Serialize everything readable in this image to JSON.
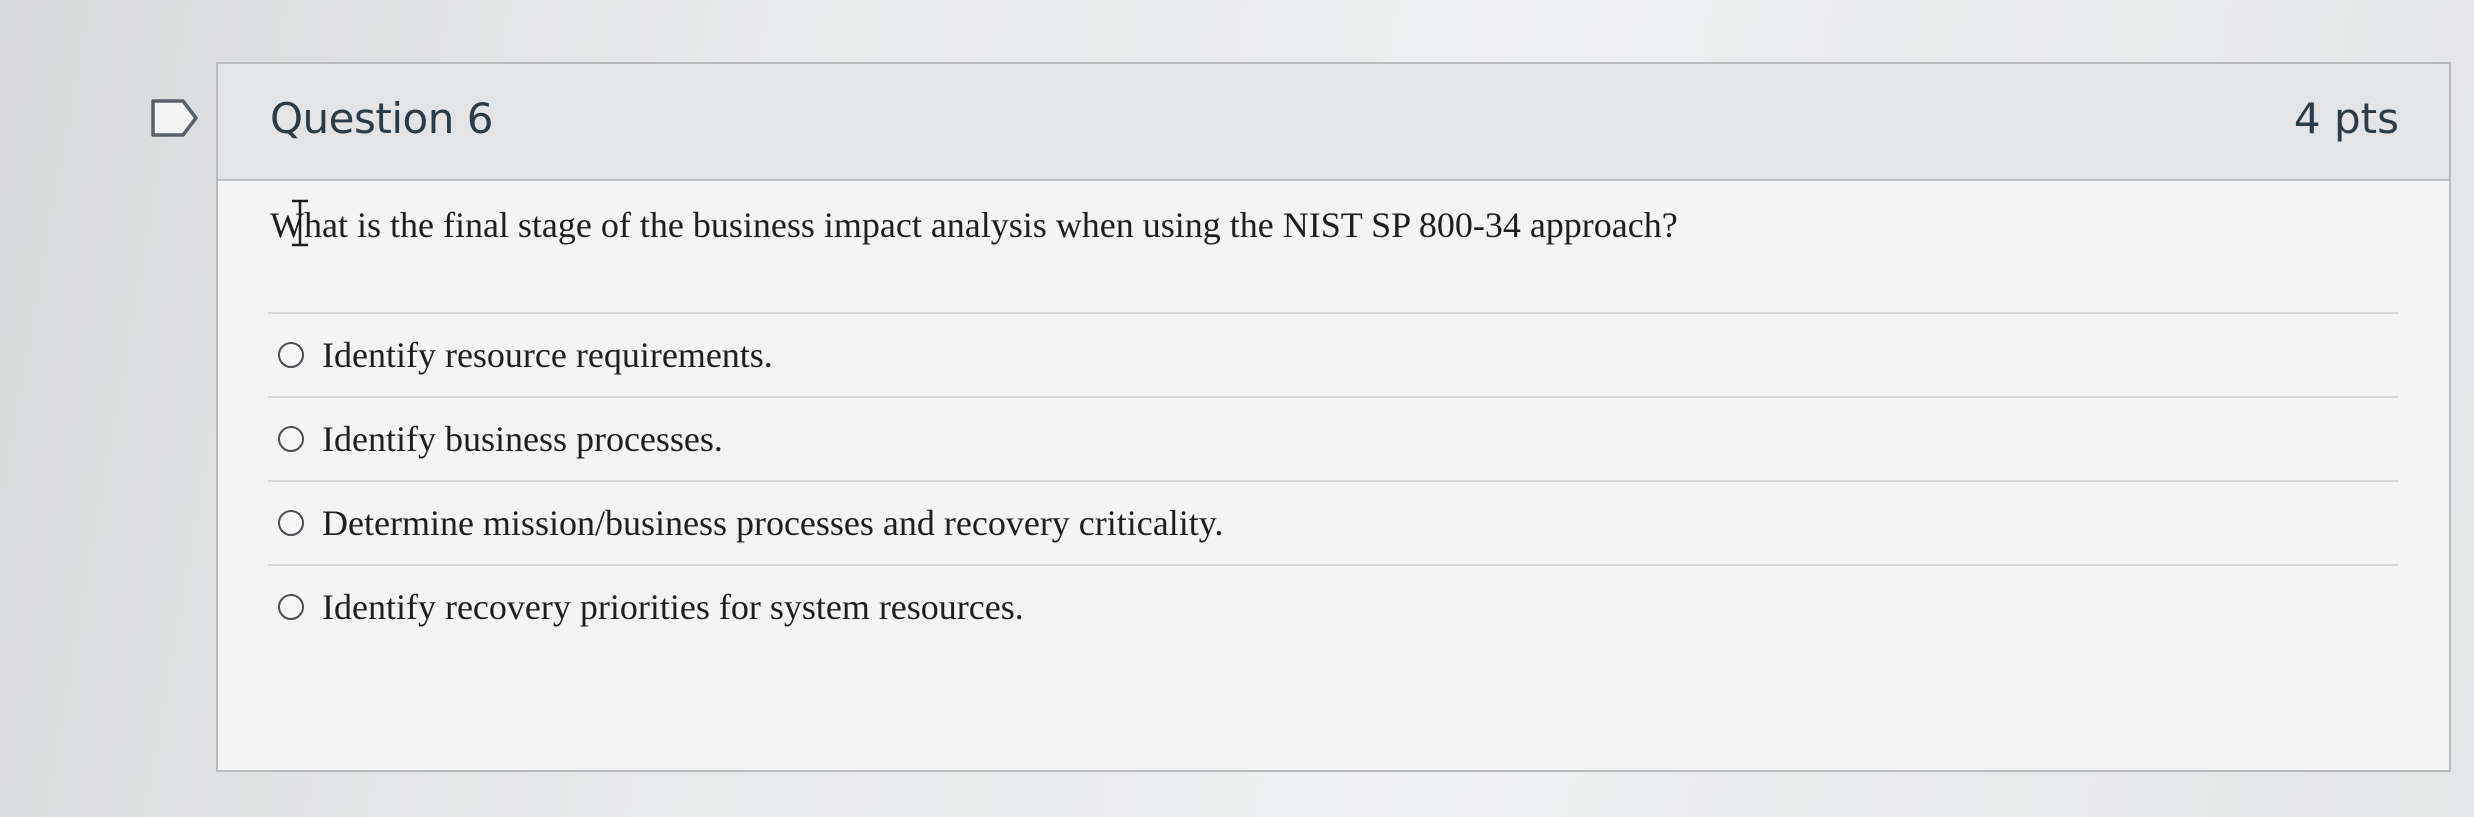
{
  "question": {
    "title": "Question 6",
    "points": "4 pts",
    "text": "What is the final stage of the business impact analysis when using the NIST SP 800-34 approach?",
    "options": [
      {
        "label": "Identify resource requirements.",
        "selected": false
      },
      {
        "label": "Identify business processes.",
        "selected": false
      },
      {
        "label": "Determine mission/business processes and recovery criticality.",
        "selected": false
      },
      {
        "label": "Identify recovery priorities for system resources.",
        "selected": false
      }
    ]
  },
  "icons": {
    "flag": "flag-icon",
    "cursor": "text-cursor-icon"
  },
  "colors": {
    "header_bg": "#e3e4e5",
    "body_bg": "#f4f4f4",
    "title_text": "#2d3b45",
    "body_text": "#1e1e1e",
    "border": "#b9bcbf"
  }
}
